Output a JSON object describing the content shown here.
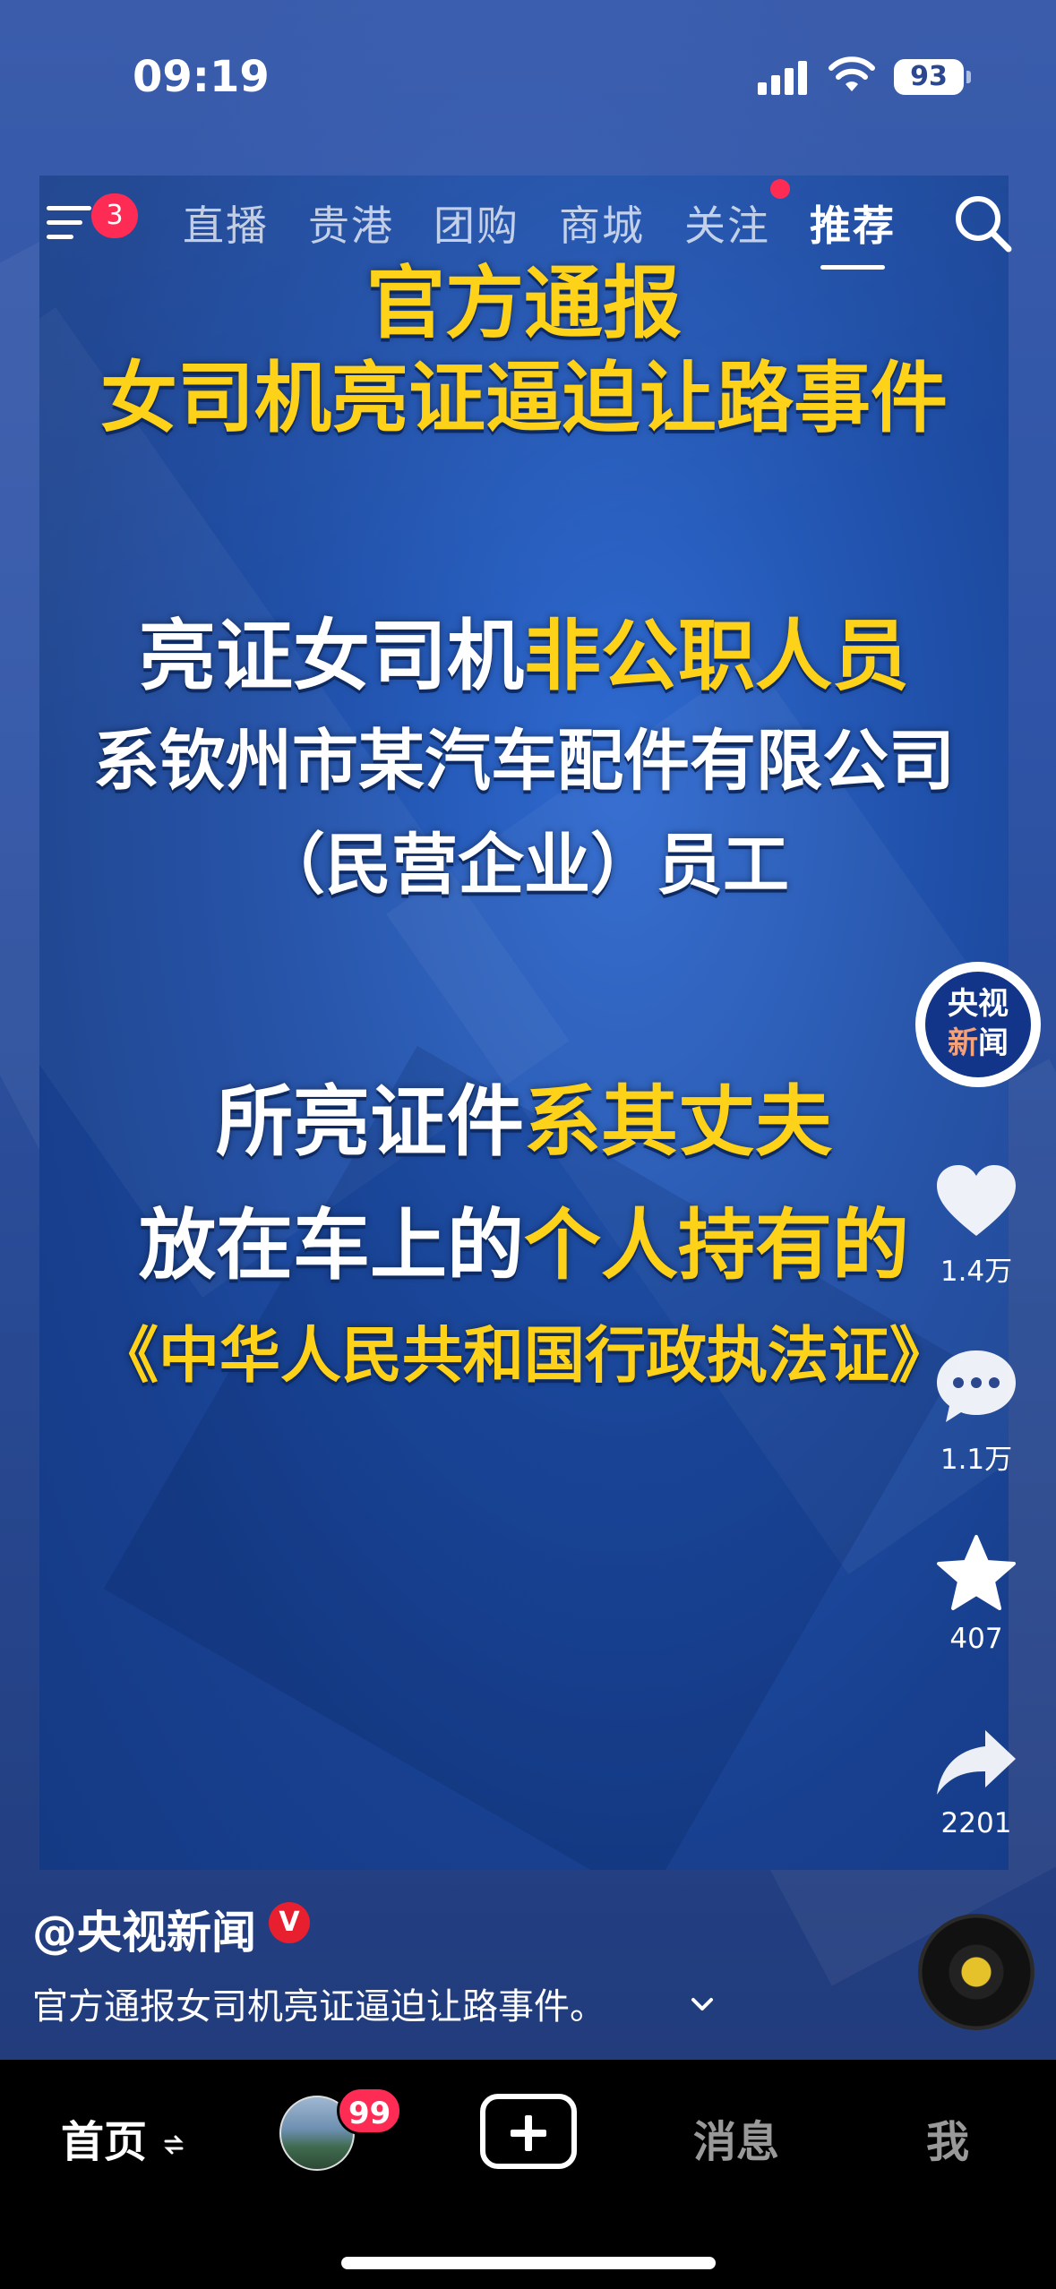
{
  "status_bar": {
    "time": "09:19",
    "battery": "93"
  },
  "top_nav": {
    "menu_badge": "3",
    "tabs": [
      {
        "label": "直播"
      },
      {
        "label": "贵港"
      },
      {
        "label": "团购"
      },
      {
        "label": "商城"
      },
      {
        "label": "关注"
      },
      {
        "label": "推荐"
      }
    ],
    "active_tab": "推荐"
  },
  "video": {
    "title_line1": "官方通报",
    "title_line2": "女司机亮证逼迫让路事件",
    "block1_line1_white": "亮证女司机",
    "block1_line1_yellow": "非公职人员",
    "block1_line2": "系钦州市某汽车配件有限公司",
    "block1_line3": "（民营企业）员工",
    "block2_line1_white": "所亮证件",
    "block2_line1_yellow": "系其丈夫",
    "block2_line2_white": "放在车上的",
    "block2_line2_yellow": "个人持有的",
    "block2_line3": "《中华人民共和国行政执法证》"
  },
  "rail": {
    "account_line1": "央视",
    "account_line2_a": "新",
    "account_line2_b": "闻",
    "likes": "1.4万",
    "comments": "1.1万",
    "favorites": "407",
    "shares": "2201"
  },
  "caption": {
    "author": "@央视新闻",
    "verified": "V",
    "text": "官方通报女司机亮证逼迫让路事件。"
  },
  "bottom_bar": {
    "home": "首页",
    "friends_badge": "99",
    "messages": "消息",
    "me": "我"
  },
  "colors": {
    "accent_red": "#fe2c55",
    "headline_yellow": "#ffd21a",
    "video_blue": "#1f4fa8"
  }
}
